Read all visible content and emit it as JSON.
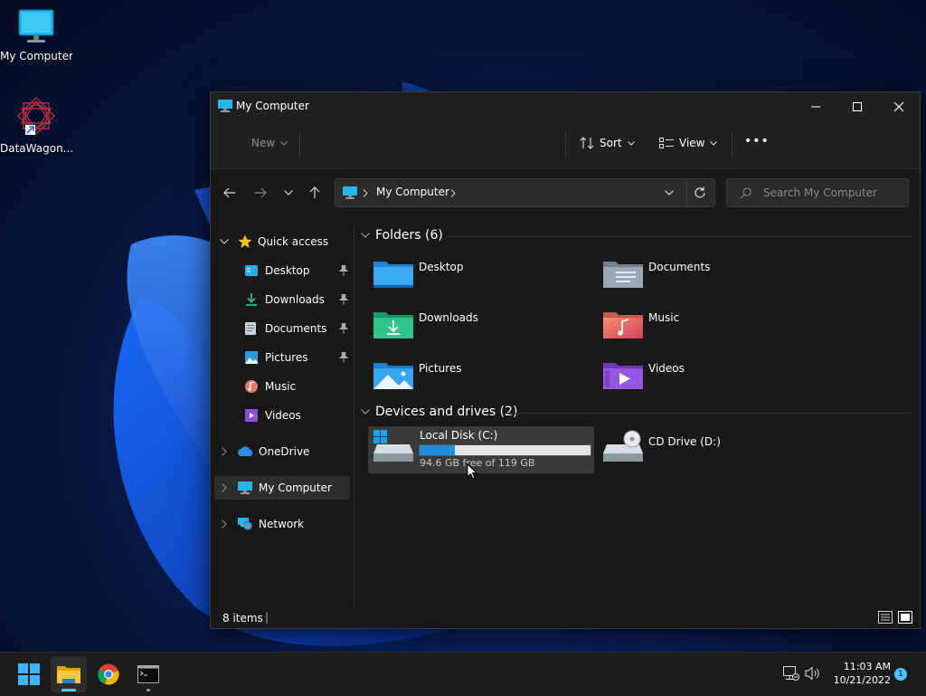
{
  "desktop": {
    "icons": [
      {
        "label": "My Computer",
        "icon": "monitor-icon"
      },
      {
        "label": "DataWagon...",
        "icon": "datawagon-shortcut-icon"
      }
    ]
  },
  "window": {
    "title": "My Computer",
    "controls": {
      "minimize": "minimize-icon",
      "maximize": "maximize-icon",
      "close": "close-icon"
    }
  },
  "commandbar": {
    "new_label": "New",
    "sort_label": "Sort",
    "view_label": "View",
    "more_label": "•••"
  },
  "navigation": {
    "breadcrumb": [
      "My Computer"
    ],
    "search_placeholder": "Search My Computer"
  },
  "sidebar": {
    "quick_access": "Quick access",
    "items": [
      {
        "label": "Desktop",
        "pinned": true
      },
      {
        "label": "Downloads",
        "pinned": true
      },
      {
        "label": "Documents",
        "pinned": true
      },
      {
        "label": "Pictures",
        "pinned": true
      },
      {
        "label": "Music",
        "pinned": false
      },
      {
        "label": "Videos",
        "pinned": false
      }
    ],
    "onedrive": "OneDrive",
    "my_computer": "My Computer",
    "network": "Network"
  },
  "content": {
    "folders_header": "Folders (6)",
    "folders": [
      {
        "label": "Desktop",
        "icon": "desktop-folder-icon"
      },
      {
        "label": "Documents",
        "icon": "documents-folder-icon"
      },
      {
        "label": "Downloads",
        "icon": "downloads-folder-icon"
      },
      {
        "label": "Music",
        "icon": "music-folder-icon"
      },
      {
        "label": "Pictures",
        "icon": "pictures-folder-icon"
      },
      {
        "label": "Videos",
        "icon": "videos-folder-icon"
      }
    ],
    "drives_header": "Devices and drives (2)",
    "drives": [
      {
        "label": "Local Disk (C:)",
        "free_text": "94.6 GB free of 119 GB",
        "used_fraction": 0.205
      },
      {
        "label": "CD Drive (D:)"
      }
    ]
  },
  "status": {
    "items_count": "8 items",
    "separator": "|"
  },
  "taskbar": {
    "apps": [
      "start-icon",
      "file-explorer-icon",
      "chrome-icon",
      "terminal-icon"
    ],
    "time": "11:03 AM",
    "date": "10/21/2022",
    "notification_count": "1"
  },
  "colors": {
    "accent": "#0078d4",
    "folder_blue": "#2aa0e8",
    "drive_bar": "#1e90e0"
  }
}
